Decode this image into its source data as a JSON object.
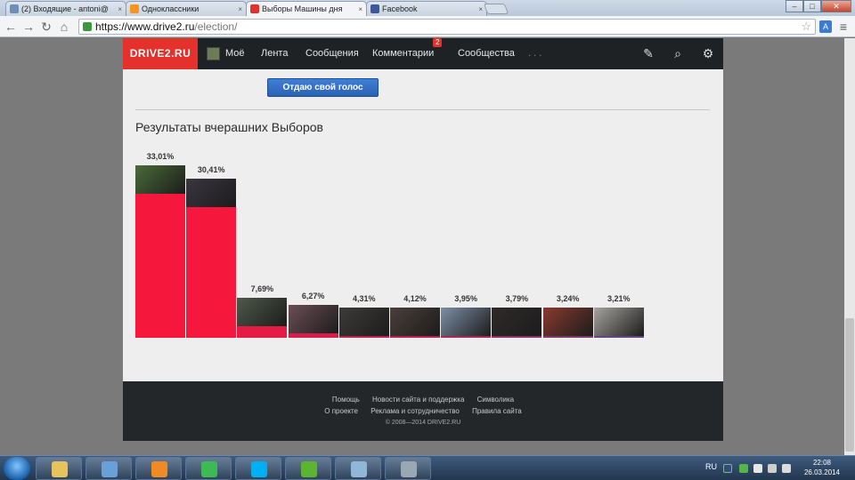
{
  "browser": {
    "tabs": [
      {
        "title": "(2) Входящие - antoni@",
        "color": "#6d8fb3"
      },
      {
        "title": "Одноклассники",
        "color": "#f7931e"
      },
      {
        "title": "Выборы Машины дня",
        "color": "#e4312b"
      },
      {
        "title": "Facebook",
        "color": "#3b5998"
      }
    ],
    "close_glyph": "×",
    "url_host": "https://www.drive2.ru",
    "url_path": "/election/",
    "icons": {
      "back": "back-arrow-icon",
      "forward": "forward-arrow-icon",
      "reload": "reload-icon",
      "home": "home-icon",
      "lock": "lock-icon",
      "star": "star-icon",
      "translate": "translate-icon",
      "menu": "menu-icon"
    },
    "glyphs": {
      "back": "←",
      "forward": "→",
      "reload": "↻",
      "home": "⌂",
      "star": "☆",
      "translate": "A",
      "menu": "≡",
      "minimize": "–",
      "maximize": "□",
      "close": "✕"
    }
  },
  "site": {
    "logo": "DRIVE2.RU",
    "nav": [
      "Моё",
      "Лента",
      "Сообщения",
      "Комментарии",
      "Сообщества",
      ". . ."
    ],
    "comments_badge": "2",
    "icon_glyphs": {
      "edit": "✎",
      "search": "⌕",
      "settings": "⚙"
    },
    "vote_button": "Отдаю свой голос",
    "results_title": "Результаты вчерашних Выборов",
    "footer": {
      "row1": [
        "Помощь",
        "Новости сайта и поддержка",
        "Символика"
      ],
      "row2": [
        "О проекте",
        "Реклама и сотрудничество",
        "Правила сайта"
      ],
      "copyright": "© 2008—2014 DRIVE2.RU"
    }
  },
  "chart_data": {
    "type": "bar",
    "categories": [
      "1",
      "2",
      "3",
      "4",
      "5",
      "6",
      "7",
      "8",
      "9",
      "10"
    ],
    "values": [
      33.01,
      30.41,
      7.69,
      6.27,
      4.31,
      4.12,
      3.95,
      3.79,
      3.24,
      3.21
    ],
    "value_labels": [
      "33,01%",
      "30,41%",
      "7,69%",
      "6,27%",
      "4,31%",
      "4,12%",
      "3,95%",
      "3,79%",
      "3,24%",
      "3,21%"
    ],
    "bar_colors": [
      "#f5173c",
      "#f5173c",
      "#e51b45",
      "#d81d4c",
      "#c91f50",
      "#b92354",
      "#a52a5c",
      "#933065",
      "#7d3a71",
      "#65477f"
    ],
    "photo_colors": [
      "#4a6b3a",
      "#3b3540",
      "#4d5a4a",
      "#6b4e55",
      "#3e3b3a",
      "#4a3f3a",
      "#7d8fa6",
      "#2f2a2a",
      "#8a3a2f",
      "#a6a39e"
    ],
    "ylim": [
      0,
      34
    ],
    "grid": false,
    "legend": "none"
  },
  "taskbar": {
    "apps": [
      {
        "name": "explorer",
        "color": "#e6c35c"
      },
      {
        "name": "computer",
        "color": "#6aa0d8"
      },
      {
        "name": "media-player",
        "color": "#f08a24"
      },
      {
        "name": "chrome",
        "color": "#3cba54"
      },
      {
        "name": "skype",
        "color": "#00aff0"
      },
      {
        "name": "utorrent",
        "color": "#5cb531"
      },
      {
        "name": "notes",
        "color": "#8fb8d8"
      },
      {
        "name": "calculator",
        "color": "#9aa7b5"
      }
    ],
    "lang": "RU",
    "time": "22:08",
    "date": "26.03.2014"
  }
}
